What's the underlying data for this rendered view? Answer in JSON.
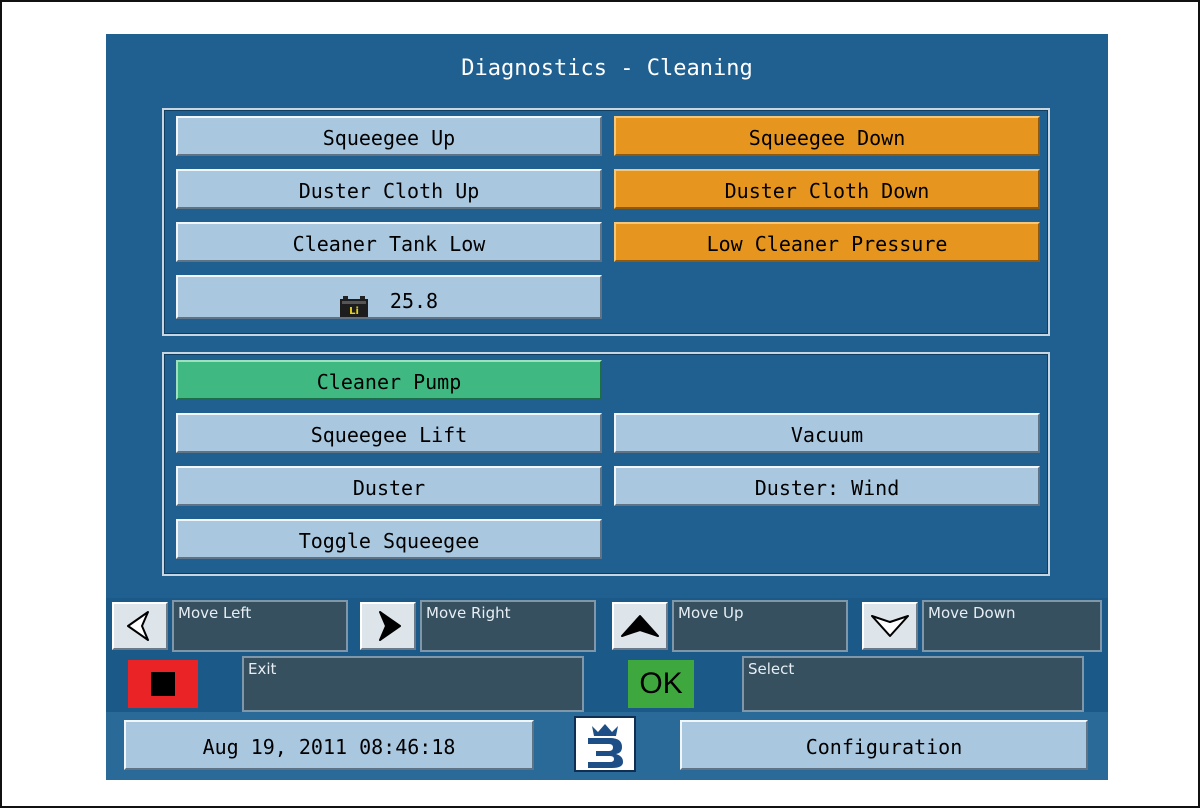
{
  "window": {
    "title": "Diagnostics - Cleaning"
  },
  "status_inputs": {
    "items": [
      {
        "label": "Squeegee Up",
        "state": "inactive"
      },
      {
        "label": "Squeegee Down",
        "state": "active"
      },
      {
        "label": "Duster Cloth Up",
        "state": "inactive"
      },
      {
        "label": "Duster Cloth Down",
        "state": "active"
      },
      {
        "label": "Cleaner Tank Low",
        "state": "inactive"
      },
      {
        "label": "Low Cleaner Pressure",
        "state": "active"
      }
    ],
    "battery": {
      "icon": "lithium-battery-icon",
      "icon_text": "Li",
      "value": "25.8"
    }
  },
  "outputs": {
    "items": [
      {
        "label": "Cleaner Pump",
        "state": "on"
      },
      {
        "label": "Squeegee Lift",
        "state": "off"
      },
      {
        "label": "Vacuum",
        "state": "off"
      },
      {
        "label": "Duster",
        "state": "off"
      },
      {
        "label": "Duster: Wind",
        "state": "off"
      },
      {
        "label": "Toggle Squeegee",
        "state": "off"
      }
    ]
  },
  "navigation": {
    "move_left": "Move Left",
    "move_right": "Move Right",
    "move_up": "Move Up",
    "move_down": "Move Down"
  },
  "commands": {
    "exit": "Exit",
    "ok_key": "OK",
    "select": "Select"
  },
  "footer": {
    "datetime": "Aug 19, 2011 08:46:18",
    "configuration": "Configuration",
    "logo_icon": "brand-logo-icon"
  },
  "colors": {
    "screen_bg": "#206090",
    "inactive": "#a9c8e0",
    "active": "#e6961f",
    "on": "#40b882",
    "exit": "#ea2326",
    "ok": "#3ea83e"
  }
}
